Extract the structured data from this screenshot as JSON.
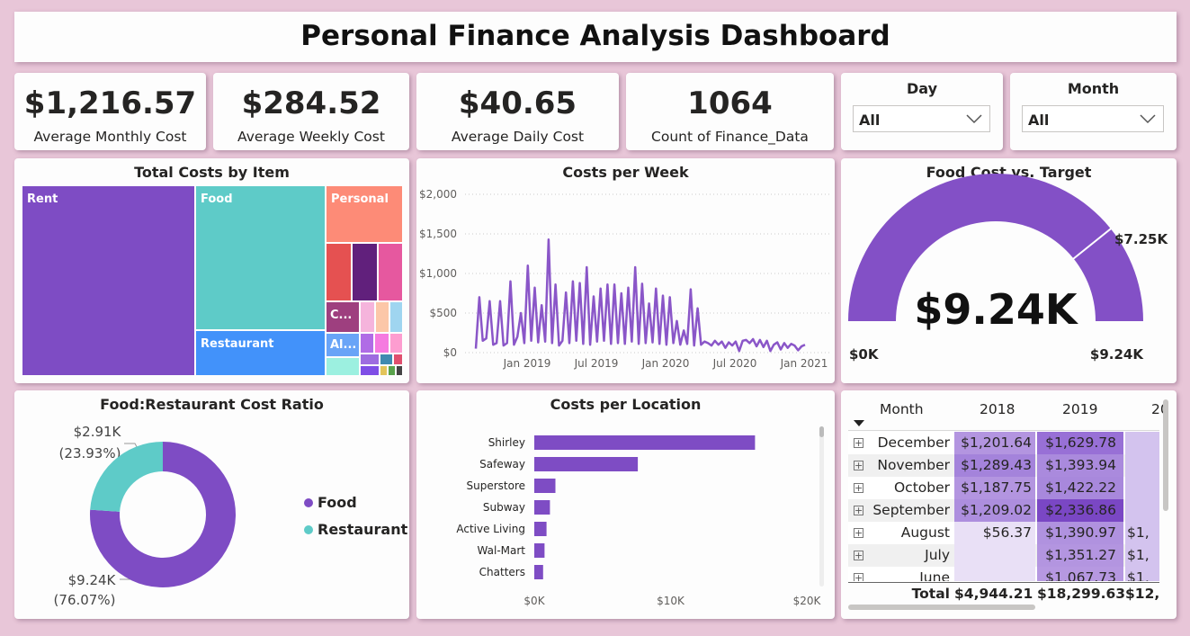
{
  "dashboard": {
    "title": "Personal Finance Analysis Dashboard"
  },
  "kpis": [
    {
      "value": "$1,216.57",
      "label": "Average Monthly Cost"
    },
    {
      "value": "$284.52",
      "label": "Average Weekly Cost"
    },
    {
      "value": "$40.65",
      "label": "Average Daily Cost"
    },
    {
      "value": "1064",
      "label": "Count of Finance_Data"
    }
  ],
  "slicers": [
    {
      "title": "Day",
      "value": "All"
    },
    {
      "title": "Month",
      "value": "All"
    }
  ],
  "treemap": {
    "title": "Total Costs by Item",
    "labels": {
      "rent": "Rent",
      "food": "Food",
      "personal": "Personal",
      "restaurant": "Restaurant",
      "c": "C...",
      "al": "Al..."
    },
    "colors": {
      "rent": "#7e4cc4",
      "food": "#5ecbc8",
      "personal": "#fd8b77",
      "restaurant": "#4292fa"
    }
  },
  "line_chart": {
    "title": "Costs per Week",
    "color": "#8a56c8",
    "chart_data": {
      "type": "line",
      "y_tick_labels": [
        "$0",
        "$500",
        "$1,000",
        "$1,500",
        "$2,000"
      ],
      "x_tick_labels": [
        "Jan 2019",
        "Jul 2019",
        "Jan 2020",
        "Jul 2020",
        "Jan 2021"
      ],
      "ylim": [
        0,
        2000
      ],
      "values": [
        50,
        700,
        150,
        180,
        650,
        100,
        120,
        650,
        90,
        120,
        900,
        100,
        200,
        500,
        120,
        1100,
        150,
        820,
        130,
        600,
        140,
        1430,
        120,
        860,
        90,
        150,
        760,
        120,
        900,
        150,
        880,
        110,
        1080,
        100,
        710,
        140,
        810,
        150,
        860,
        110,
        860,
        120,
        750,
        110,
        820,
        140,
        1080,
        110,
        870,
        120,
        620,
        130,
        810,
        110,
        720,
        100,
        700,
        120,
        400,
        100,
        280,
        110,
        800,
        90,
        560,
        100,
        140,
        120,
        90,
        150,
        100,
        140,
        60,
        130,
        90,
        140,
        20,
        150,
        160,
        120,
        170,
        80,
        160,
        70,
        150,
        20,
        100,
        130,
        40,
        120,
        60,
        110,
        90,
        30,
        80,
        100
      ]
    }
  },
  "gauge": {
    "title": "Food Cost vs. Target",
    "value_label": "$9.24K",
    "min_label": "$0K",
    "max_label": "$9.24K",
    "target_label": "$7.25K",
    "chart_data": {
      "type": "gauge",
      "value": 9240,
      "min": 0,
      "max": 9240,
      "target": 7250
    },
    "color": "#8350c6"
  },
  "donut": {
    "title": "Food:Restaurant Cost Ratio",
    "chart_data": {
      "type": "pie",
      "slices": [
        {
          "name": "Food",
          "value": 9.24,
          "label": "$9.24K",
          "pct": "(76.07%)",
          "color": "#7e4cc4"
        },
        {
          "name": "Restaurant",
          "value": 2.91,
          "label": "$2.91K",
          "pct": "(23.93%)",
          "color": "#5ecbc8"
        }
      ]
    }
  },
  "bar_chart": {
    "title": "Costs per Location",
    "color": "#7e4cc4",
    "chart_data": {
      "type": "bar",
      "categories": [
        "Shirley",
        "Safeway",
        "Superstore",
        "Subway",
        "Active Living",
        "Wal-Mart",
        "Chatters"
      ],
      "values": [
        16200,
        7600,
        1550,
        1150,
        900,
        750,
        650
      ],
      "x_tick_labels": [
        "$0K",
        "$10K",
        "$20K"
      ],
      "xlim": [
        0,
        20000
      ]
    }
  },
  "matrix": {
    "header_month": "Month",
    "year_headers": [
      "2018",
      "2019",
      "20"
    ],
    "rows": [
      {
        "month": "December",
        "y2018": "$1,201.64",
        "y2019": "$1,629.78",
        "y2020": ""
      },
      {
        "month": "November",
        "y2018": "$1,289.43",
        "y2019": "$1,393.94",
        "y2020": ""
      },
      {
        "month": "October",
        "y2018": "$1,187.75",
        "y2019": "$1,422.22",
        "y2020": ""
      },
      {
        "month": "September",
        "y2018": "$1,209.02",
        "y2019": "$2,336.86",
        "y2020": ""
      },
      {
        "month": "August",
        "y2018": "$56.37",
        "y2019": "$1,390.97",
        "y2020": "$1,"
      },
      {
        "month": "July",
        "y2018": "",
        "y2019": "$1,351.27",
        "y2020": "$1,"
      },
      {
        "month": "June",
        "y2018": "",
        "y2019": "$1,067.73",
        "y2020": "$1,"
      }
    ],
    "total": {
      "label": "Total",
      "y2018": "$4,944.21",
      "y2019": "$18,299.63",
      "y2020": "$12,("
    }
  }
}
